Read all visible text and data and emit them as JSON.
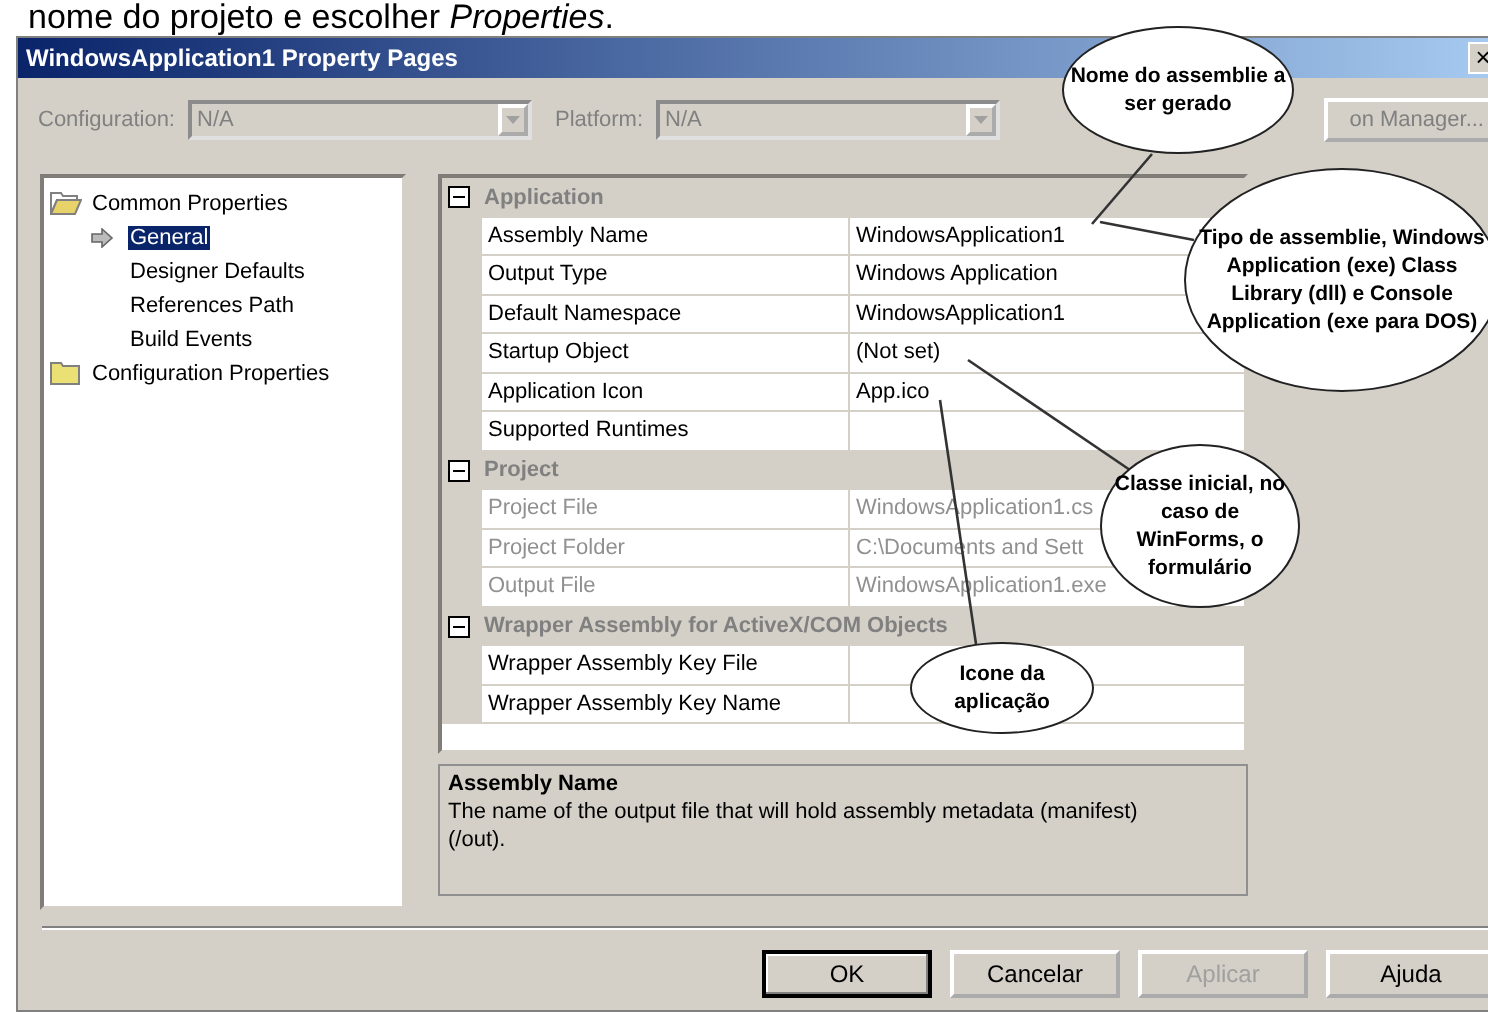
{
  "caption": "nome do projeto e escolher *Properties*.",
  "window": {
    "title": "WindowsApplication1 Property Pages",
    "close": "×"
  },
  "config_bar": {
    "configuration_label": "Configuration:",
    "configuration_value": "N/A",
    "platform_label": "Platform:",
    "platform_value": "N/A",
    "manager_button": "on Manager...",
    "disabled": true
  },
  "tree": [
    {
      "label": "Common Properties",
      "expanded": true,
      "selected": false,
      "children": [
        {
          "label": "General",
          "selected": true
        },
        {
          "label": "Designer Defaults",
          "selected": false
        },
        {
          "label": "References Path",
          "selected": false
        },
        {
          "label": "Build Events",
          "selected": false
        }
      ]
    },
    {
      "label": "Configuration Properties",
      "expanded": false,
      "selected": false
    }
  ],
  "property_grid": {
    "sections": [
      {
        "title": "Application",
        "expanded": true,
        "rows": [
          {
            "name": "Assembly Name",
            "value": "WindowsApplication1",
            "disabled": false
          },
          {
            "name": "Output Type",
            "value": "Windows Application",
            "disabled": false
          },
          {
            "name": "Default Namespace",
            "value": "WindowsApplication1",
            "disabled": false
          },
          {
            "name": "Startup Object",
            "value": "(Not set)",
            "disabled": false
          },
          {
            "name": "Application Icon",
            "value": "App.ico",
            "disabled": false
          },
          {
            "name": "Supported Runtimes",
            "value": "",
            "disabled": false
          }
        ]
      },
      {
        "title": "Project",
        "expanded": true,
        "rows": [
          {
            "name": "Project File",
            "value": "WindowsApplication1.cs",
            "disabled": true
          },
          {
            "name": "Project Folder",
            "value": "C:\\Documents and Sett",
            "disabled": true
          },
          {
            "name": "Output File",
            "value": "WindowsApplication1.exe",
            "disabled": true
          }
        ]
      },
      {
        "title": "Wrapper Assembly for ActiveX/COM Objects",
        "expanded": true,
        "rows": [
          {
            "name": "Wrapper Assembly Key File",
            "value": "",
            "disabled": false
          },
          {
            "name": "Wrapper Assembly Key Name",
            "value": "",
            "disabled": false
          }
        ]
      }
    ]
  },
  "description": {
    "title": "Assembly Name",
    "text": "The name of the output file that will hold assembly metadata (manifest) (/out)."
  },
  "buttons": [
    {
      "label": "OK",
      "default": true,
      "disabled": false
    },
    {
      "label": "Cancelar",
      "default": false,
      "disabled": false
    },
    {
      "label": "Aplicar",
      "default": false,
      "disabled": true
    },
    {
      "label": "Ajuda",
      "default": false,
      "disabled": false
    }
  ],
  "callouts": [
    {
      "text": "Nome do assemblie a ser gerado"
    },
    {
      "text": "Tipo de assemblie, Windows Application (exe) Class Library (dll) e Console Application (exe para DOS)"
    },
    {
      "text": "Classe inicial, no caso de WinForms, o formulário"
    },
    {
      "text": "Icone da aplicação"
    }
  ]
}
